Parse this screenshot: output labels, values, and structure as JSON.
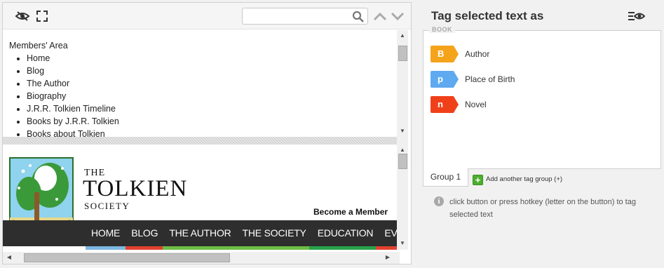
{
  "toolbar": {
    "icons": {
      "visibility": "eye-slash-icon",
      "expand": "expand-icon",
      "search": "search-icon",
      "prev": "chevron-up-icon",
      "next": "chevron-down-icon"
    },
    "search_value": "",
    "search_placeholder": ""
  },
  "text_frame": {
    "heading": "Members' Area",
    "items": [
      "Home",
      "Blog",
      "The Author",
      "Biography",
      "J.R.R. Tolkien Timeline",
      "Books by J.R.R. Tolkien",
      "Books about Tolkien"
    ]
  },
  "web_frame": {
    "logo": {
      "banner_text": "TOLKIEN SOCIETY"
    },
    "brand": {
      "the": "THE",
      "name": "TOLKIEN",
      "society": "SOCIETY"
    },
    "become_member": "Become a Member",
    "nav": [
      "HOME",
      "BLOG",
      "THE AUTHOR",
      "THE SOCIETY",
      "EDUCATION",
      "EV"
    ],
    "nav_colors": [
      "#7bb6e2",
      "#e2422e",
      "#6dbd45",
      "#6dbd45",
      "#27a24a",
      "#e2422e",
      "#e8a33c"
    ]
  },
  "tag_panel": {
    "title": "Tag selected text as",
    "menu_icon": "eye-menu-icon",
    "group_legend": "BOOK",
    "tags": [
      {
        "key": "B",
        "label": "Author",
        "color": "#f5a31a"
      },
      {
        "key": "p",
        "label": "Place of Birth",
        "color": "#5fa9f0"
      },
      {
        "key": "n",
        "label": "Novel",
        "color": "#f0401a"
      }
    ],
    "group_tab": "Group 1",
    "add_group": {
      "icon": "plus-icon",
      "label": "Add another tag group (+)"
    },
    "info": {
      "icon": "info-icon",
      "text": "click button or press hotkey (letter on the button) to tag selected text"
    }
  }
}
